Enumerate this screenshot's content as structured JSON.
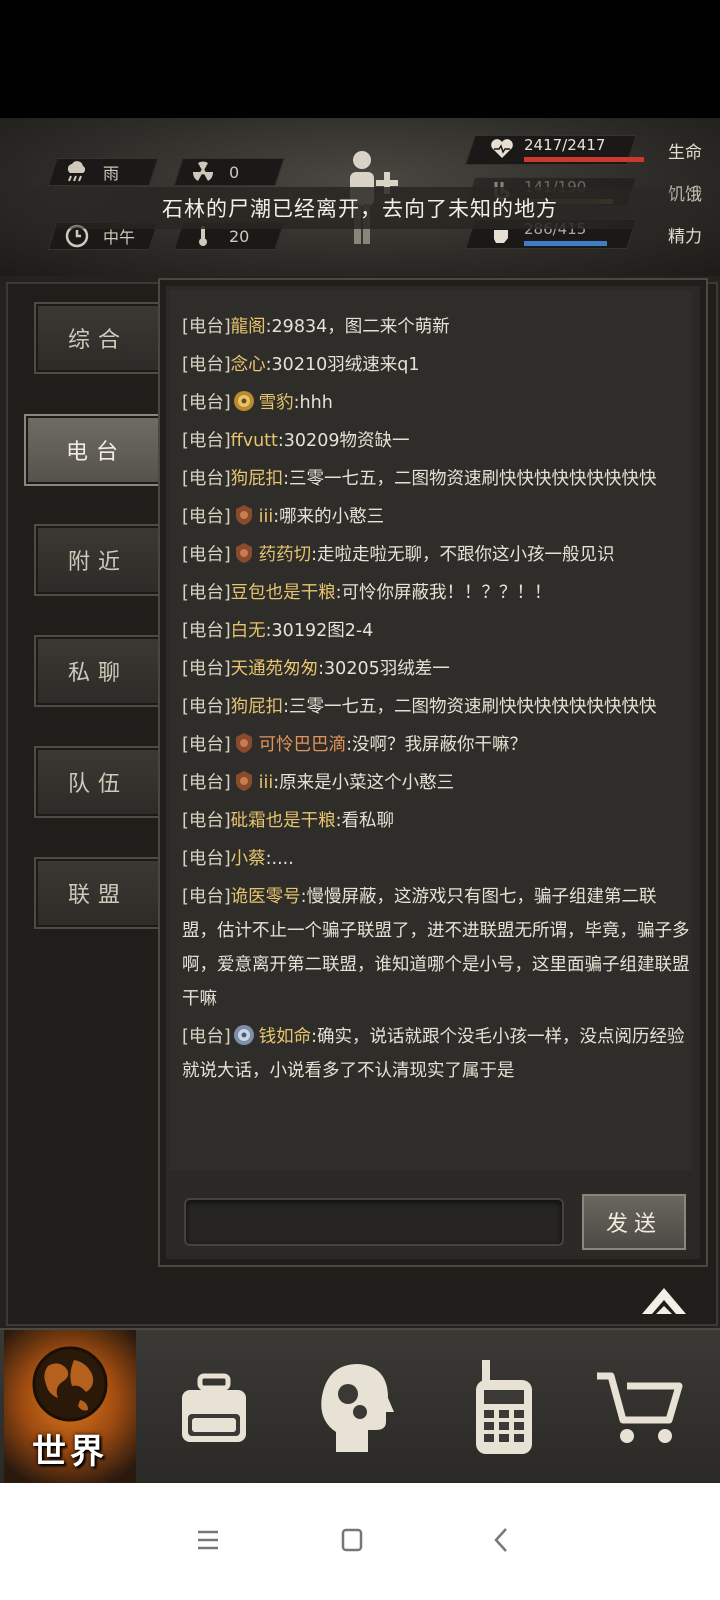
{
  "hud": {
    "weather_label": "雨",
    "radiation_value": "0",
    "time_label": "中午",
    "temperature_value": "20",
    "life": {
      "value": "2417/2417",
      "label": "生命",
      "fraction": 1.0,
      "color": "#c93a2e"
    },
    "hunger": {
      "value": "141/190",
      "label": "饥饿",
      "fraction": 0.74,
      "color": "#a07a3a"
    },
    "energy": {
      "value": "286/415",
      "label": "精力",
      "fraction": 0.69,
      "color": "#3f7ec4"
    }
  },
  "toast": "石林的尸潮已经离开，去向了未知的地方",
  "tabs": [
    {
      "label": "综合"
    },
    {
      "label": "电台"
    },
    {
      "label": "附近"
    },
    {
      "label": "私聊"
    },
    {
      "label": "队伍"
    },
    {
      "label": "联盟"
    }
  ],
  "chat": {
    "channel": "[电台]",
    "messages": [
      {
        "name": "龍阁",
        "text": ":29834，图二来个萌新",
        "badge": ""
      },
      {
        "name": "念心",
        "text": ":30210羽绒速来q1",
        "badge": ""
      },
      {
        "name": "雪豹",
        "text": ":hhh",
        "badge": "gold-crest-icon"
      },
      {
        "name": "ffvutt",
        "text": ":30209物资缺一",
        "badge": ""
      },
      {
        "name": "狗屁扣",
        "text": ":三零一七五，二图物资速刷快快快快快快快快快",
        "badge": ""
      },
      {
        "name": "iii",
        "text": ":哪来的小憨三",
        "badge": "bronze-crest-icon"
      },
      {
        "name": "药药切",
        "text": ":走啦走啦无聊，不跟你这小孩一般见识",
        "badge": "bronze-crest-icon"
      },
      {
        "name": "豆包也是干粮",
        "text": ":可怜你屏蔽我！！？？！！",
        "badge": ""
      },
      {
        "name": "白无",
        "text": ":30192图2-4",
        "badge": ""
      },
      {
        "name": "天通苑匆匆",
        "text": ":30205羽绒差一",
        "badge": ""
      },
      {
        "name": "狗屁扣",
        "text": ":三零一七五，二图物资速刷快快快快快快快快快",
        "badge": ""
      },
      {
        "name": "可怜巴巴滴",
        "text": ":没啊？我屏蔽你干嘛？",
        "badge": "bronze-crest-icon",
        "name_color": "orange"
      },
      {
        "name": "iii",
        "text": ":原来是小菜这个小憨三",
        "badge": "bronze-crest-icon"
      },
      {
        "name": "砒霜也是干粮",
        "text": ":看私聊",
        "badge": ""
      },
      {
        "name": "小蔡",
        "text": ":....",
        "badge": ""
      },
      {
        "name": "诡医零号",
        "text": ":慢慢屏蔽，这游戏只有图七，骗子组建第二联盟，估计不止一个骗子联盟了，进不进联盟无所谓，毕竟，骗子多啊，爱意离开第二联盟，谁知道哪个是小号，这里面骗子组建联盟干嘛",
        "badge": ""
      },
      {
        "name": "钱如命",
        "text": ":确实，说话就跟个没毛小孩一样，没点阅历经验就说大话，小说看多了不认清现实了属于是",
        "badge": "silver-crest-icon"
      }
    ],
    "input_placeholder": "",
    "send_label": "发送"
  },
  "bottom_nav": {
    "world_label": "世界",
    "items": [
      "globe-icon",
      "backpack-icon",
      "skills-head-icon",
      "radio-icon",
      "shop-cart-icon"
    ]
  }
}
